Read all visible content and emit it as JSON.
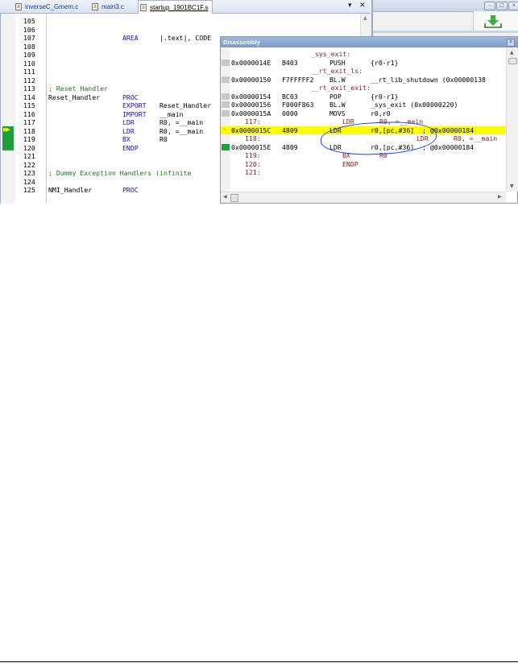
{
  "tabs": [
    {
      "label": "inverseC_Gmem.c",
      "active": false
    },
    {
      "label": "main3.c",
      "active": false
    },
    {
      "label": "startup_1901BC1F.s",
      "active": true
    }
  ],
  "tab_controls": {
    "dropdown": "▾",
    "close": "✕"
  },
  "editor": {
    "lines": [
      {
        "n": "105",
        "c1": "",
        "c2": "",
        "c3": ""
      },
      {
        "n": "106",
        "c1": "",
        "c2": "",
        "c3": ""
      },
      {
        "n": "107",
        "c1": "",
        "c2": "AREA",
        "c3": "|.text|, CODE"
      },
      {
        "n": "108",
        "c1": "",
        "c2": "",
        "c3": ""
      },
      {
        "n": "109",
        "c1": "",
        "c2": "",
        "c3": ""
      },
      {
        "n": "110",
        "c1": "",
        "c2": "",
        "c3": ""
      },
      {
        "n": "111",
        "c1": "",
        "c2": "",
        "c3": ""
      },
      {
        "n": "112",
        "c1": "",
        "c2": "",
        "c3": ""
      },
      {
        "n": "113",
        "c1": "; Reset Handler",
        "c2": "",
        "c3": ""
      },
      {
        "n": "114",
        "c1": "Reset_Handler",
        "c2": "PROC",
        "c3": ""
      },
      {
        "n": "115",
        "c1": "",
        "c2": "EXPORT",
        "c3": "Reset_Handler"
      },
      {
        "n": "116",
        "c1": "",
        "c2": "IMPORT",
        "c3": "__main"
      },
      {
        "n": "117",
        "c1": "",
        "c2": "LDR",
        "c3": "R0, =__main"
      },
      {
        "n": "118",
        "c1": "",
        "c2": "LDR",
        "c3": "R0, =__main"
      },
      {
        "n": "119",
        "c1": "",
        "c2": "BX",
        "c3": "R0"
      },
      {
        "n": "120",
        "c1": "",
        "c2": "ENDP",
        "c3": ""
      },
      {
        "n": "121",
        "c1": "",
        "c2": "",
        "c3": ""
      },
      {
        "n": "122",
        "c1": "",
        "c2": "",
        "c3": ""
      },
      {
        "n": "123",
        "c1": "; Dummy Exception Handlers (infinite",
        "c2": "",
        "c3": ""
      },
      {
        "n": "124",
        "c1": "",
        "c2": "",
        "c3": ""
      },
      {
        "n": "125",
        "c1": "NMI_Handler",
        "c2": "PROC",
        "c3": ""
      }
    ]
  },
  "disassembly": {
    "title": "Disassembly",
    "close": "x",
    "lines": [
      {
        "kind": "label",
        "text": "_sys_exit:"
      },
      {
        "kind": "asm",
        "marker": "gray",
        "addr": "0x0000014E",
        "hex": "B403",
        "mn": "PUSH",
        "op": "{r0-r1}"
      },
      {
        "kind": "label",
        "text": "__rt_exit_ls:"
      },
      {
        "kind": "asm",
        "marker": "gray",
        "addr": "0x00000150",
        "hex": "F7FFFFF2",
        "mn": "BL.W",
        "op": "__rt_lib_shutdown (0x00000138"
      },
      {
        "kind": "label",
        "text": "__rt_exit_exit:"
      },
      {
        "kind": "asm",
        "marker": "gray",
        "addr": "0x00000154",
        "hex": "BC03",
        "mn": "POP",
        "op": "{r0-r1}"
      },
      {
        "kind": "asm",
        "marker": "gray",
        "addr": "0x00000156",
        "hex": "F000F863",
        "mn": "BL.W",
        "op": "_sys_exit (0x00000220)"
      },
      {
        "kind": "asm",
        "marker": "gray",
        "addr": "0x0000015A",
        "hex": "0000",
        "mn": "MOVS",
        "op": "r0,r0"
      },
      {
        "kind": "src",
        "no": "117:",
        "mn": "LDR",
        "op": "R0, =__main"
      },
      {
        "kind": "asm",
        "marker": "arrow",
        "highlight": true,
        "addr": "0x0000015C",
        "hex": "4809",
        "mn": "LDR",
        "op": "r0,[pc,#36]  ; @0x00000184"
      },
      {
        "kind": "src2",
        "no": "118:",
        "mn": "LDR",
        "op": "R0, =__main"
      },
      {
        "kind": "asm",
        "marker": "green",
        "addr": "0x0000015E",
        "hex": "4809",
        "mn": "LDR",
        "op": "r0,[pc,#36]  ; @0x00000184"
      },
      {
        "kind": "src",
        "no": "119:",
        "mn": "BX",
        "op": "R0"
      },
      {
        "kind": "src",
        "no": "120:",
        "mn": "ENDP",
        "op": ""
      },
      {
        "kind": "src",
        "no": "121:",
        "mn": "",
        "op": ""
      }
    ]
  },
  "colors": {
    "highlight": "#ffff00",
    "exec_marker": "#1c9f3c",
    "keyword": "#1010d0",
    "source_line": "#8b1a1a",
    "annotation": "#2040e0"
  },
  "icons": {
    "file": "file-icon",
    "exec_arrow": "double-arrow-icon",
    "current_arrow": "arrow-right-icon",
    "download": "download-icon"
  }
}
